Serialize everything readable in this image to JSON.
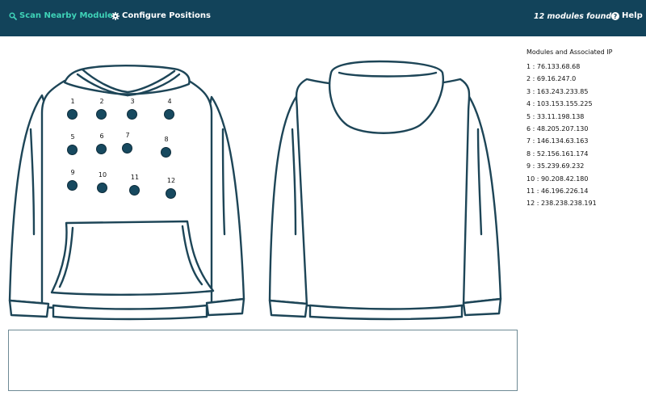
{
  "nav": {
    "scan_label": "Scan Nearby Modules",
    "configure_label": "Configure Positions",
    "status_text": "12 modules found.",
    "help_label": "Help"
  },
  "colors": {
    "nav_bg": "#12435a",
    "accent": "#3fd3b8",
    "module_fill": "#17495f",
    "garment_stroke": "#1d4557"
  },
  "sidebar": {
    "title": "Modules and Associated IP",
    "entries": [
      "1 : 76.133.68.68",
      "2 : 69.16.247.0",
      "3 : 163.243.233.85",
      "4 : 103.153.155.225",
      "5 : 33.11.198.138",
      "6 : 48.205.207.130",
      "7 : 146.134.63.163",
      "8 : 52.156.161.174",
      "9 : 35.239.69.232",
      "10 : 90.208.42.180",
      "11 : 46.196.226.14",
      "12 : 238.238.238.191"
    ]
  },
  "modules": [
    "1",
    "2",
    "3",
    "4",
    "5",
    "6",
    "7",
    "8",
    "9",
    "10",
    "11",
    "12"
  ],
  "output": {
    "text": ""
  }
}
